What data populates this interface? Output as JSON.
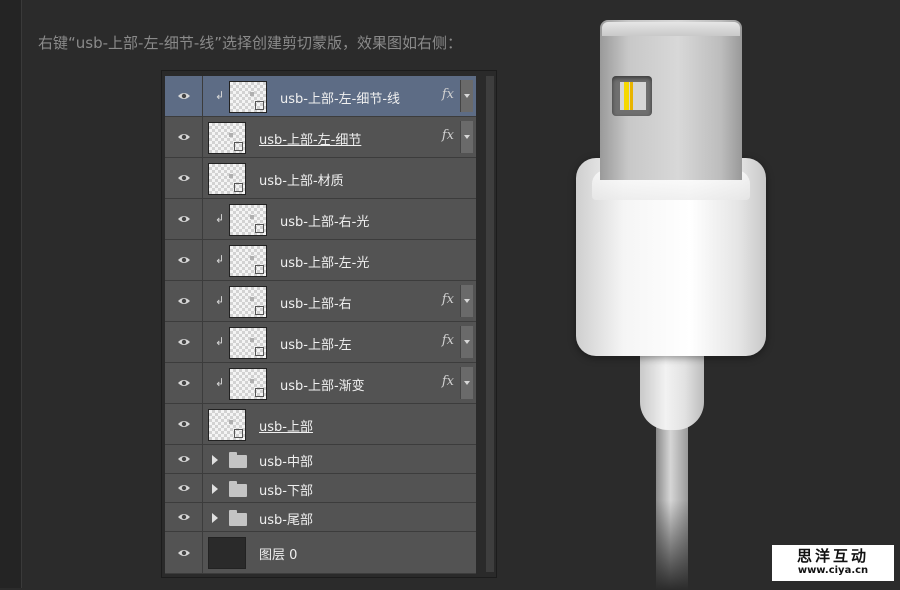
{
  "instruction": "右键“usb-上部-左-细节-线”选择创建剪切蒙版，效果图如右侧：",
  "layers": [
    {
      "name": "usb-上部-左-细节-线",
      "clipped": true,
      "fx": true,
      "selected": true,
      "underline": false
    },
    {
      "name": "usb-上部-左-细节",
      "clipped": false,
      "fx": true,
      "selected": false,
      "underline": true
    },
    {
      "name": "usb-上部-材质",
      "clipped": false,
      "fx": false,
      "selected": false,
      "underline": false
    },
    {
      "name": "usb-上部-右-光",
      "clipped": true,
      "fx": false,
      "selected": false,
      "underline": false
    },
    {
      "name": "usb-上部-左-光",
      "clipped": true,
      "fx": false,
      "selected": false,
      "underline": false
    },
    {
      "name": "usb-上部-右",
      "clipped": true,
      "fx": true,
      "selected": false,
      "underline": false
    },
    {
      "name": "usb-上部-左",
      "clipped": true,
      "fx": true,
      "selected": false,
      "underline": false
    },
    {
      "name": "usb-上部-渐变",
      "clipped": true,
      "fx": true,
      "selected": false,
      "underline": false
    },
    {
      "name": "usb-上部",
      "clipped": false,
      "fx": false,
      "selected": false,
      "underline": true
    }
  ],
  "groups": [
    {
      "name": "usb-中部"
    },
    {
      "name": "usb-下部"
    },
    {
      "name": "usb-尾部"
    }
  ],
  "background_layer": {
    "name": "图层 0"
  },
  "fx_label": "fx",
  "clip_glyph": "↲",
  "watermark": {
    "title": "思洋互动",
    "url": "www.ciya.cn"
  },
  "icons": {
    "visibility": "eye-icon",
    "group": "folder-icon",
    "expand": "triangle-right-icon"
  },
  "colors": {
    "panel_row": "#535353",
    "selected_row": "#5d6c85",
    "background": "#2b2b2b"
  }
}
